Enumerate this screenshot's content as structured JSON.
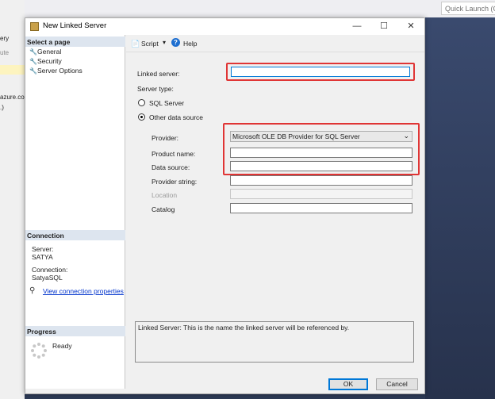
{
  "ide": {
    "quick_launch": "Quick Launch (C",
    "fragments": [
      "ery",
      "ute",
      "azure.co",
      ".)"
    ]
  },
  "dialog": {
    "title": "New Linked Server",
    "controls": {
      "minimize": "—",
      "maximize": "☐",
      "close": "✕"
    },
    "left": {
      "select_page_header": "Select a page",
      "pages": [
        "General",
        "Security",
        "Server Options"
      ],
      "connection_header": "Connection",
      "server_label": "Server:",
      "server_value": "SATYA",
      "connection_label": "Connection:",
      "connection_value": "SatyaSQL",
      "view_props": "View connection properties",
      "progress_header": "Progress",
      "progress_status": "Ready"
    },
    "toolbar": {
      "script": "Script",
      "help": "Help"
    },
    "form": {
      "linked_server_label": "Linked server:",
      "linked_server_value": "",
      "server_type_label": "Server type:",
      "sql_server_option": "SQL Server",
      "other_source_option": "Other data source",
      "selected_server_type": "Other data source",
      "provider_label": "Provider:",
      "provider_value": "Microsoft OLE DB Provider for SQL Server",
      "product_name_label": "Product name:",
      "data_source_label": "Data source:",
      "provider_string_label": "Provider string:",
      "location_label": "Location",
      "catalog_label": "Catalog"
    },
    "description": "Linked Server: This is the name the linked server will be referenced by.",
    "buttons": {
      "ok": "OK",
      "cancel": "Cancel"
    },
    "highlight_color": "#e03535"
  }
}
